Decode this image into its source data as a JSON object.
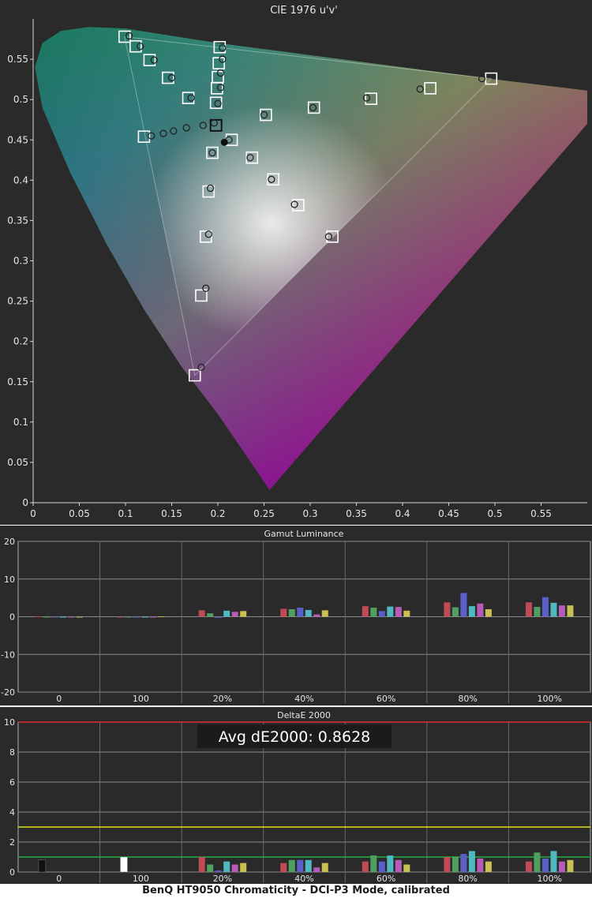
{
  "caption": "BenQ HT9050 Chromaticity - DCI-P3 Mode, calibrated",
  "colors": {
    "panel_bg": "#2a2a2a",
    "axis": "#d8d8d8",
    "grid": "#8a8a8a",
    "ref_red_line": "#e03030",
    "ref_yellow_line": "#e0e020",
    "ref_green_line": "#20b040",
    "badge_bg": "#1b1b1b",
    "badge_text": "#ffffff"
  },
  "chart_data": [
    {
      "type": "scatter",
      "title": "CIE 1976 u'v'",
      "xlim": [
        0,
        0.6
      ],
      "ylim": [
        0,
        0.6
      ],
      "x_ticks": [
        "0",
        "0.05",
        "0.1",
        "0.15",
        "0.2",
        "0.25",
        "0.3",
        "0.35",
        "0.4",
        "0.45",
        "0.5",
        "0.55"
      ],
      "y_ticks": [
        "0",
        "0.05",
        "0.1",
        "0.15",
        "0.2",
        "0.25",
        "0.3",
        "0.35",
        "0.4",
        "0.45",
        "0.5",
        "0.55"
      ],
      "gamut_primaries": {
        "red": [
          0.496,
          0.526
        ],
        "green": [
          0.099,
          0.578
        ],
        "blue": [
          0.175,
          0.158
        ]
      },
      "white_point": [
        0.198,
        0.468
      ],
      "targets": [
        [
          0.099,
          0.578
        ],
        [
          0.111,
          0.566
        ],
        [
          0.126,
          0.549
        ],
        [
          0.146,
          0.527
        ],
        [
          0.168,
          0.502
        ],
        [
          0.202,
          0.565
        ],
        [
          0.201,
          0.545
        ],
        [
          0.2,
          0.528
        ],
        [
          0.199,
          0.514
        ],
        [
          0.198,
          0.496
        ],
        [
          0.12,
          0.454
        ],
        [
          0.198,
          0.468
        ],
        [
          0.252,
          0.481
        ],
        [
          0.304,
          0.49
        ],
        [
          0.366,
          0.501
        ],
        [
          0.43,
          0.514
        ],
        [
          0.496,
          0.526
        ],
        [
          0.215,
          0.45
        ],
        [
          0.237,
          0.428
        ],
        [
          0.26,
          0.401
        ],
        [
          0.287,
          0.369
        ],
        [
          0.324,
          0.33
        ],
        [
          0.194,
          0.434
        ],
        [
          0.19,
          0.386
        ],
        [
          0.187,
          0.33
        ],
        [
          0.182,
          0.257
        ],
        [
          0.175,
          0.158
        ]
      ],
      "measured": [
        [
          0.104,
          0.579
        ],
        [
          0.116,
          0.566
        ],
        [
          0.131,
          0.549
        ],
        [
          0.15,
          0.527
        ],
        [
          0.171,
          0.502
        ],
        [
          0.205,
          0.564
        ],
        [
          0.205,
          0.55
        ],
        [
          0.203,
          0.533
        ],
        [
          0.203,
          0.515
        ],
        [
          0.2,
          0.495
        ],
        [
          0.128,
          0.455
        ],
        [
          0.141,
          0.458
        ],
        [
          0.152,
          0.461
        ],
        [
          0.166,
          0.465
        ],
        [
          0.184,
          0.468
        ],
        [
          0.196,
          0.471
        ],
        [
          0.25,
          0.481
        ],
        [
          0.303,
          0.49
        ],
        [
          0.361,
          0.502
        ],
        [
          0.419,
          0.513
        ],
        [
          0.486,
          0.526
        ],
        [
          0.212,
          0.45
        ],
        [
          0.235,
          0.428
        ],
        [
          0.258,
          0.401
        ],
        [
          0.283,
          0.37
        ],
        [
          0.32,
          0.33
        ],
        [
          0.194,
          0.434
        ],
        [
          0.192,
          0.39
        ],
        [
          0.19,
          0.333
        ],
        [
          0.187,
          0.266
        ],
        [
          0.182,
          0.168
        ]
      ],
      "measured_white": [
        0.207,
        0.447
      ]
    },
    {
      "type": "bar",
      "title": "Gamut Luminance",
      "categories": [
        "0",
        "100",
        "20%",
        "40%",
        "60%",
        "80%",
        "100%"
      ],
      "series_colors": [
        "#c04a55",
        "#4fa060",
        "#5a60c8",
        "#50b8c0",
        "#b85ab8",
        "#c8c050"
      ],
      "values": [
        [
          0.1,
          0.0,
          0.0,
          0.0,
          0.0,
          0.0
        ],
        [
          0.0,
          0.0,
          0.0,
          0.0,
          0.0,
          0.1
        ],
        [
          1.7,
          0.9,
          -0.3,
          1.6,
          1.3,
          1.5
        ],
        [
          2.1,
          2.0,
          2.4,
          1.8,
          0.6,
          1.7
        ],
        [
          2.8,
          2.4,
          1.5,
          2.7,
          2.6,
          1.6
        ],
        [
          3.8,
          2.5,
          6.3,
          2.8,
          3.5,
          2.0
        ],
        [
          3.8,
          2.6,
          5.2,
          3.7,
          3.0,
          3.0
        ]
      ],
      "ylim": [
        -20,
        20
      ],
      "y_ticks": [
        "20",
        "10",
        "0",
        "-10",
        "-20"
      ]
    },
    {
      "type": "bar",
      "title": "DeltaE 2000",
      "annotation": "Avg dE2000: 0.8628",
      "categories": [
        "0",
        "100",
        "20%",
        "40%",
        "60%",
        "80%",
        "100%"
      ],
      "series_colors": [
        "#c04a55",
        "#4fa060",
        "#5a60c8",
        "#50b8c0",
        "#b85ab8",
        "#c8c050"
      ],
      "single_colors": [
        "#111111",
        "#ffffff"
      ],
      "values": [
        [
          0.8
        ],
        [
          1.0
        ],
        [
          1.0,
          0.5,
          0.1,
          0.7,
          0.5,
          0.6
        ],
        [
          0.6,
          0.8,
          0.8,
          0.8,
          0.3,
          0.6
        ],
        [
          0.7,
          1.1,
          0.7,
          1.1,
          0.8,
          0.5
        ],
        [
          1.0,
          1.0,
          1.2,
          1.4,
          0.9,
          0.7
        ],
        [
          0.7,
          1.3,
          0.9,
          1.4,
          0.7,
          0.8
        ]
      ],
      "ylim": [
        0,
        10
      ],
      "y_ticks": [
        "10",
        "8",
        "6",
        "4",
        "2",
        "0"
      ],
      "reference_lines": [
        10,
        3,
        1
      ]
    }
  ]
}
